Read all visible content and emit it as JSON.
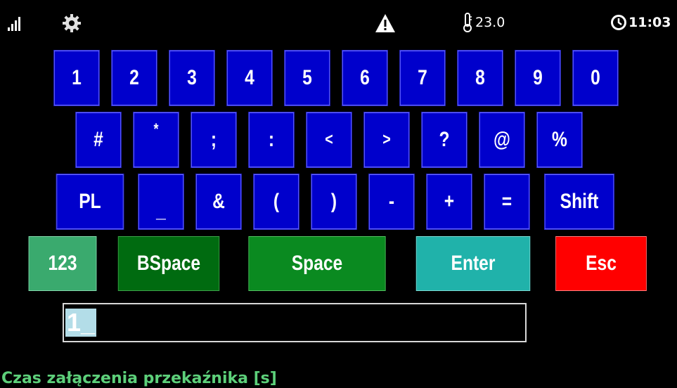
{
  "status_bar": {
    "temperature": "23.0",
    "time": "11:03",
    "icons": [
      "signal-icon",
      "gear-icon",
      "warning-icon",
      "thermometer-icon",
      "clock-icon"
    ]
  },
  "keyboard": {
    "row1": [
      "1",
      "2",
      "3",
      "4",
      "5",
      "6",
      "7",
      "8",
      "9",
      "0"
    ],
    "row2": [
      "#",
      "*",
      ";",
      ":",
      "<",
      ">",
      "?",
      "@",
      "%"
    ],
    "row3": [
      "PL",
      "_",
      "&",
      "(",
      ")",
      "-",
      "+",
      "=",
      "Shift"
    ],
    "row4": [
      "123",
      "BSpace",
      "Space",
      "Enter",
      "Esc"
    ]
  },
  "input": {
    "value": "1_"
  },
  "field_label": "Czas załączenia przekaźnika [s]",
  "colors": {
    "key_blue": "#0000cc",
    "key_123": "#3aaa6e",
    "key_bspace": "#006b10",
    "key_space": "#0a8a20",
    "key_enter": "#20b2aa",
    "key_esc": "#ff0000",
    "label_green": "#5dd07a"
  }
}
